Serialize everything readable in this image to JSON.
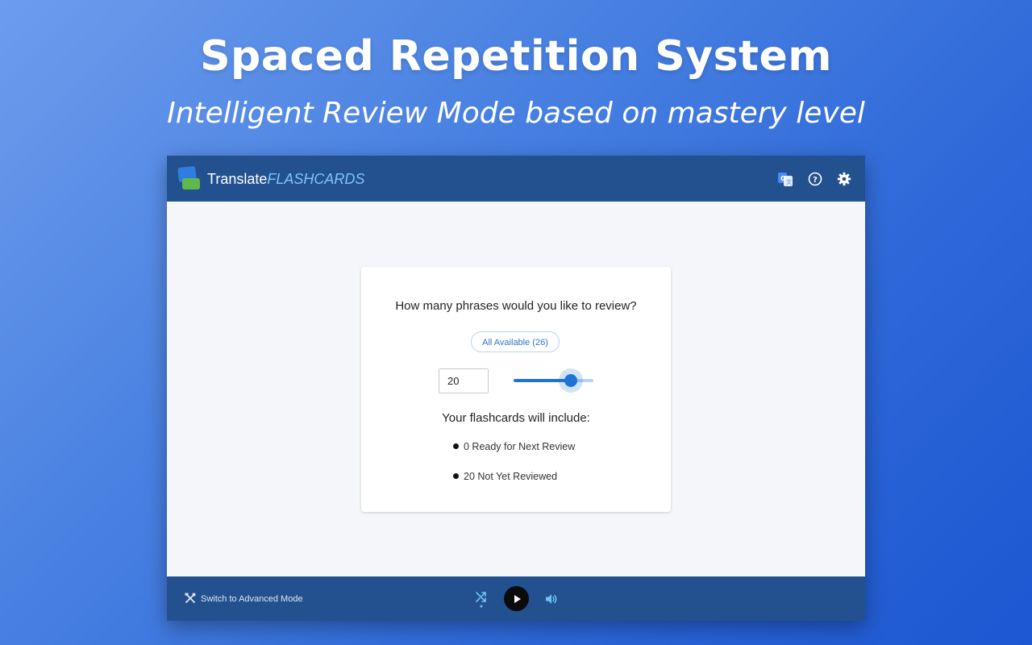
{
  "hero": {
    "title": "Spaced Repetition System",
    "subtitle": "Intelligent Review Mode based on mastery level"
  },
  "app": {
    "title_main": "Translate",
    "title_accent": "FLASHCARDS",
    "header_icons": [
      "translate-icon",
      "help-icon",
      "settings-gear-icon"
    ],
    "colors": {
      "header_bg": "#23518f",
      "accent": "#1f73d4",
      "title_accent": "#7fc4f8"
    }
  },
  "review_card": {
    "question": "How many phrases would you like to review?",
    "all_available_label": "All Available (26)",
    "count_value": "20",
    "slider_fraction": 0.72,
    "include_heading": "Your flashcards will include:",
    "items": [
      "0 Ready for Next Review",
      "20 Not Yet Reviewed"
    ]
  },
  "footer": {
    "advanced_mode_label": "Switch to Advanced Mode",
    "controls": [
      "shuffle-icon",
      "play-icon",
      "volume-icon"
    ]
  }
}
